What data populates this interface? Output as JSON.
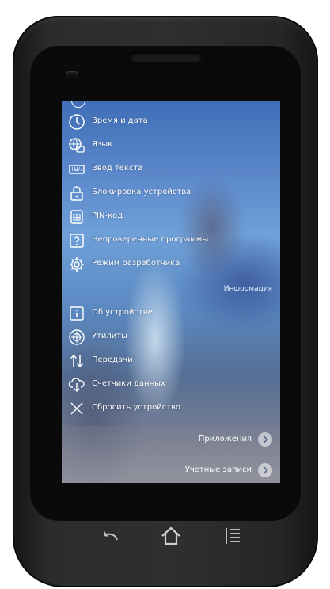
{
  "settings_menu": {
    "items": [
      {
        "label": "Время и дата",
        "icon": "clock-icon"
      },
      {
        "label": "Язык",
        "icon": "language-icon"
      },
      {
        "label": "Ввод текста",
        "icon": "keyboard-icon"
      },
      {
        "label": "Блокировка устройства",
        "icon": "lock-icon"
      },
      {
        "label": "PIN-код",
        "icon": "sim-card-icon"
      },
      {
        "label": "Непроверенные программы",
        "icon": "question-icon"
      },
      {
        "label": "Режим разработчика",
        "icon": "gear-icon"
      },
      {
        "label": "Об устройстве",
        "icon": "info-icon"
      },
      {
        "label": "Утилиты",
        "icon": "plus-circle-icon"
      },
      {
        "label": "Передачи",
        "icon": "transfer-arrows-icon"
      },
      {
        "label": "Счетчики данных",
        "icon": "cloud-download-icon"
      },
      {
        "label": "Сбросить устройство",
        "icon": "close-icon"
      }
    ],
    "section_info": "Информация"
  },
  "links": {
    "apps": "Приложения",
    "accounts": "Учетные записи"
  },
  "colors": {
    "text": "#ffffff",
    "screen_top": "#3f6fb8",
    "phone_body": "#2b2b2b"
  }
}
